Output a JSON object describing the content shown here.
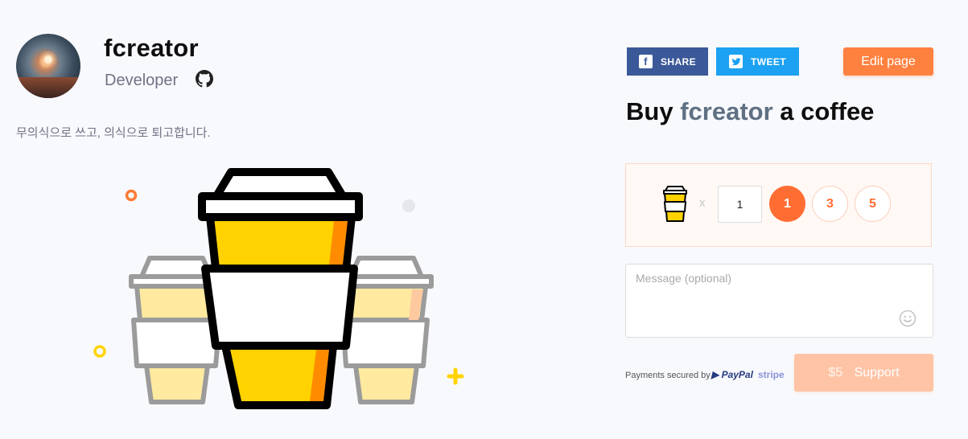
{
  "profile": {
    "name": "fcreator",
    "role": "Developer",
    "bio": "무의식으로 쓰고, 의식으로 퇴고합니다.",
    "links": [
      {
        "icon": "github-icon"
      }
    ]
  },
  "share": {
    "facebook": {
      "label": "SHARE",
      "icon": "facebook-icon",
      "color": "#3b5998"
    },
    "twitter": {
      "label": "TWEET",
      "icon": "twitter-icon",
      "color": "#1da1f2"
    }
  },
  "edit_button": "Edit page",
  "headline": {
    "prefix": "Buy",
    "name": "fcreator",
    "suffix": "a coffee"
  },
  "coffee": {
    "multiplier": "x",
    "quantity": "1",
    "quick_options": [
      "1",
      "3",
      "5"
    ],
    "selected": "1"
  },
  "message": {
    "placeholder": "Message (optional)",
    "emoji_icon": "smiley-icon"
  },
  "payment": {
    "label": "Payments secured by",
    "providers": [
      "PayPal",
      "stripe"
    ]
  },
  "support": {
    "amount": "$5",
    "label": "Support"
  },
  "colors": {
    "accent": "#ff813f",
    "page_bg": "#f8f9fc",
    "support_disabled": "#ffc4a6"
  }
}
